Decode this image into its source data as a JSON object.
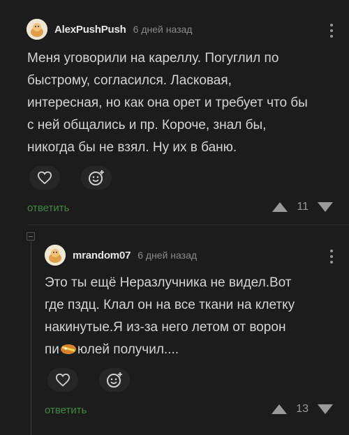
{
  "comments": [
    {
      "username": "AlexPushPush",
      "timestamp": "6 дней назад",
      "text_lines": [
        "Меня уговорили на кареллу. Погуглил по",
        "быстрому, согласился. Ласковая,",
        "интересная, но как она орет и требует что бы",
        "с ней общались и пр. Короче, знал бы,",
        "никогда бы не взял. Ну их в баню."
      ],
      "reply_label": "ответить",
      "votes": "11"
    },
    {
      "username": "mrandom07",
      "timestamp": "6 дней назад",
      "text_lines": [
        "Это ты ещё Неразлучника не видел.Вот",
        "где пздц. Клал он на все ткани на клетку",
        "накинутые.Я из-за него летом от ворон",
        "пи",
        "юлей получил...."
      ],
      "reply_label": "ответить",
      "votes": "13"
    }
  ],
  "icons": {
    "heart": "heart-icon",
    "emoji": "add-emoji-icon",
    "upvote": "upvote-arrow-icon",
    "downvote": "downvote-arrow-icon",
    "more": "more-vertical-icon",
    "censor": "censor-sticker-icon"
  },
  "colors": {
    "background": "#1c1c1c",
    "reply": "#3f8a40",
    "text": "#d4d4d4"
  }
}
